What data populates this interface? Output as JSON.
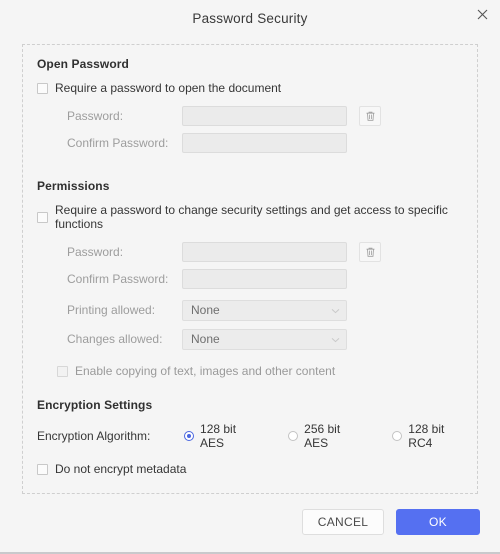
{
  "dialog": {
    "title": "Password Security",
    "close_icon": "close-icon"
  },
  "colors": {
    "accent": "#5570f1",
    "radio_accent": "#4a66e0",
    "background": "#f5f5f5",
    "input_fill": "#ebebeb",
    "border": "#dcdcdc"
  },
  "open_password": {
    "section_title": "Open Password",
    "require_checkbox_label": "Require a password to open the document",
    "require_checked": false,
    "password_label": "Password:",
    "password_value": "",
    "password_clear_icon": "trash-icon",
    "confirm_label": "Confirm Password:",
    "confirm_value": ""
  },
  "permissions": {
    "section_title": "Permissions",
    "require_checkbox_label": "Require a password to change security settings and get access to specific functions",
    "require_checked": false,
    "password_label": "Password:",
    "password_value": "",
    "password_clear_icon": "trash-icon",
    "confirm_label": "Confirm Password:",
    "confirm_value": "",
    "printing_label": "Printing allowed:",
    "printing_value": "None",
    "printing_chevron_icon": "chevron-down-icon",
    "changes_label": "Changes allowed:",
    "changes_value": "None",
    "changes_chevron_icon": "chevron-down-icon",
    "enable_copy_label": "Enable copying of text, images and other content",
    "enable_copy_checked": false
  },
  "encryption": {
    "section_title": "Encryption Settings",
    "algorithm_label": "Encryption Algorithm:",
    "options": [
      {
        "label": "128 bit AES",
        "selected": true
      },
      {
        "label": "256 bit AES",
        "selected": false
      },
      {
        "label": "128 bit RC4",
        "selected": false
      }
    ],
    "no_metadata_label": "Do not encrypt metadata",
    "no_metadata_checked": false
  },
  "footer": {
    "cancel_label": "CANCEL",
    "ok_label": "OK"
  }
}
